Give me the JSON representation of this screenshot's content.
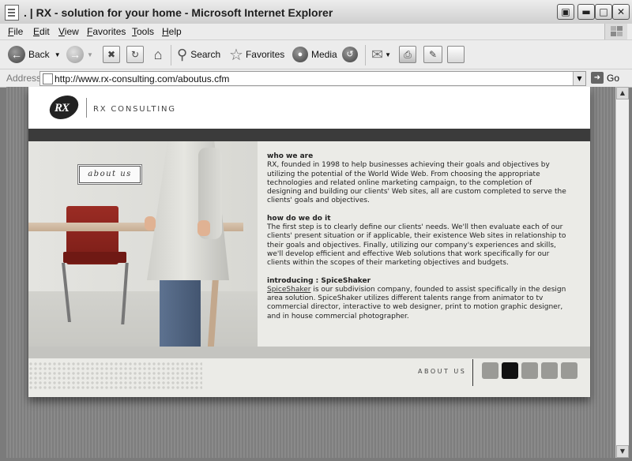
{
  "window": {
    "title": ". | RX - solution for your home - Microsoft Internet Explorer",
    "controls": [
      "restore",
      "minimize",
      "maximize",
      "close"
    ]
  },
  "menubar": {
    "items": [
      "File",
      "Edit",
      "View",
      "Favorites",
      "Tools",
      "Help"
    ]
  },
  "toolbar": {
    "back_label": "Back",
    "search_label": "Search",
    "favorites_label": "Favorites",
    "media_label": "Media"
  },
  "addressbar": {
    "label": "Address",
    "url": "http://www.rx-consulting.com/aboutus.cfm",
    "go_label": "Go"
  },
  "site": {
    "brand": "RX CONSULTING",
    "logo_text": "RX",
    "about_button": "about us",
    "sections": [
      {
        "heading": "who we are",
        "body": "RX, founded in 1998 to help businesses achieving their goals and objectives by utilizing the potential of the World Wide Web. From choosing the appropriate technologies and related online marketing campaign, to the completion of designing and building our clients' Web sites, all are custom completed to serve the clients' goals and objectives."
      },
      {
        "heading": "how do we do it",
        "body": "The first step is to clearly define our clients' needs. We'll then evaluate each of our clients' present situation or if applicable, their existence Web sites in relationship to their goals and objectives. Finally, utilizing our company's experiences and skills, we'll develop efficient and effective Web solutions that work specifically for our clients within the scopes of their marketing objectives and budgets."
      },
      {
        "heading": "introducing : SpiceShaker",
        "link": "SpiceShaker",
        "body": " is our subdivision company, founded to assist specifically in the design area solution. SpiceShaker utilizes different talents range from animator to tv commercial director, interactive to web designer, print to motion graphic designer, and in house commercial photographer."
      }
    ],
    "footer_nav_label": "ABOUT US",
    "footer_nav_active_index": 1,
    "footer_nav_count": 5
  },
  "colors": {
    "dark_band": "#3b3b3b",
    "page_bg": "#ebebe7",
    "nav_active": "#111111",
    "nav_inactive": "#9a9a96"
  }
}
